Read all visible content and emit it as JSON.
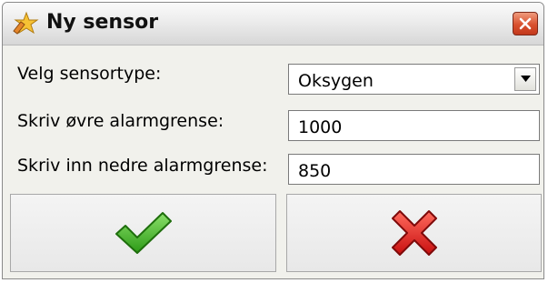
{
  "window": {
    "title": "Ny sensor",
    "app_icon": "sensor-star-icon",
    "close_icon": "close-icon"
  },
  "form": {
    "sensor_type": {
      "label": "Velg sensortype:",
      "value": "Oksygen"
    },
    "upper_alarm": {
      "label": "Skriv øvre alarmgrense:",
      "value": "1000"
    },
    "lower_alarm": {
      "label": "Skriv inn nedre alarmgrense:",
      "value": "850"
    }
  },
  "actions": {
    "ok_icon": "checkmark-icon",
    "cancel_icon": "red-x-icon"
  },
  "colors": {
    "ok_green": "#4fbf2a",
    "cancel_red": "#d61f1f",
    "titlebar": "#e6e6e6",
    "dialog_bg": "#f1f1ec"
  }
}
